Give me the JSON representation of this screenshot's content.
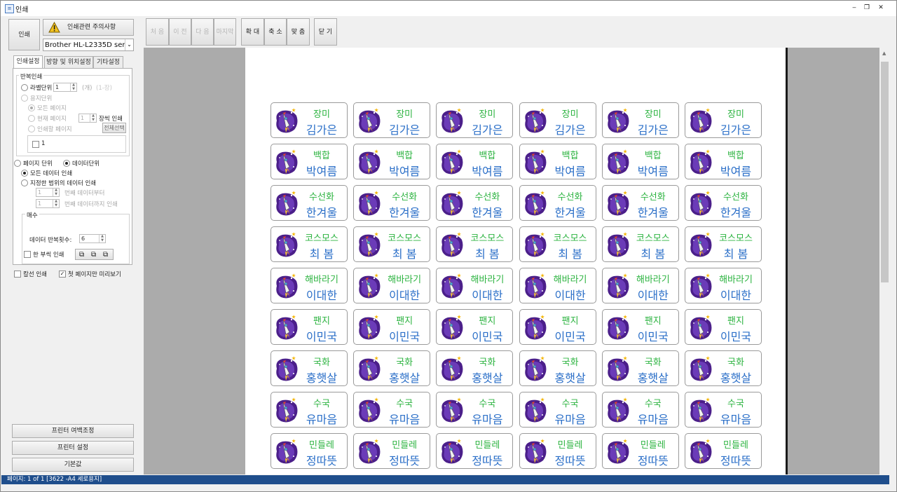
{
  "window": {
    "title": "인쇄",
    "app_icon": "document-icon",
    "min": "‒",
    "restore": "❐",
    "close": "✕"
  },
  "left": {
    "print_button": "인쇄",
    "notice_button": "인쇄관련 주의사항",
    "printer": "Brother HL-L2335D series(",
    "tabs": [
      "인쇄설정",
      "방향 및 위치설정",
      "기타설정"
    ],
    "repeat_group": "반복인쇄",
    "label_unit": "라벨단위",
    "label_unit_value": "1",
    "label_unit_suffix": "(개)",
    "label_unit_hint": "(1-장)",
    "sheet_unit": "용지단위",
    "all_pages": "모든 페이지",
    "current_page": "현재 페이지",
    "current_page_value": "1",
    "current_page_suffix": "장씩 인쇄",
    "print_pages": "인쇄할 페이지",
    "select_all": "전체선택",
    "page_item": "1",
    "page_unit": "페이지 단위",
    "data_unit": "데이터단위",
    "all_data": "모든 데이터 인쇄",
    "range_data": "지정한 범위의 데이터 인쇄",
    "from_value": "1",
    "from_suffix": "번째 데이터부터",
    "to_value": "1",
    "to_suffix": "번째 데이터까지 인쇄",
    "copies_group": "매수",
    "data_repeat": "데이터 반복횟수:",
    "data_repeat_value": "6",
    "one_copy": "한 부씩 인쇄",
    "cut_line": "칼선 인쇄",
    "first_page_preview": "첫 페이지만 미리보기",
    "margin_button": "프린터 여백조정",
    "printer_settings_button": "프린터 설정",
    "default_button": "기본값"
  },
  "toolbar": {
    "first": "처 음",
    "prev": "이 전",
    "next": "다 음",
    "last": "마지막",
    "zoom_in": "확 대",
    "zoom_out": "축 소",
    "fit": "맞 춤",
    "close": "닫 기"
  },
  "labels": {
    "columns": 6,
    "rows": [
      {
        "class": "장미",
        "name": "김가은"
      },
      {
        "class": "백합",
        "name": "박여름"
      },
      {
        "class": "수선화",
        "name": "한겨울"
      },
      {
        "class": "코스모스",
        "name": "최  봄"
      },
      {
        "class": "해바라기",
        "name": "이대한"
      },
      {
        "class": "팬지",
        "name": "이민국"
      },
      {
        "class": "국화",
        "name": "홍햇살"
      },
      {
        "class": "수국",
        "name": "유마음"
      },
      {
        "class": "민들레",
        "name": "정따뜻"
      }
    ],
    "icon": "rocket-icon",
    "class_color": "#2cb340",
    "name_color": "#2b6fc8"
  },
  "status": "페이지: 1 of 1 [3622 -A4 세로용지]"
}
